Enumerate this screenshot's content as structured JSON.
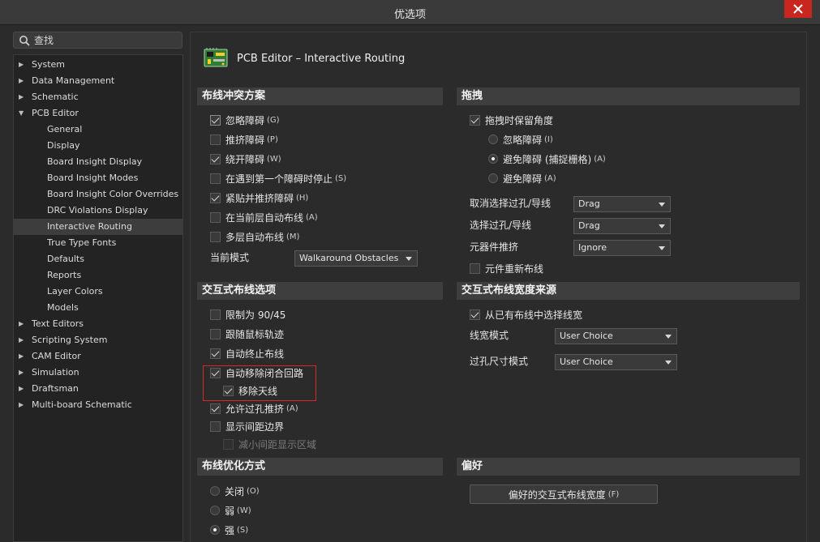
{
  "window": {
    "title": "优选项"
  },
  "search": {
    "placeholder": "查找"
  },
  "tree": {
    "items": [
      {
        "label": "System",
        "level": 0,
        "expanded": false
      },
      {
        "label": "Data Management",
        "level": 0,
        "expanded": false
      },
      {
        "label": "Schematic",
        "level": 0,
        "expanded": false
      },
      {
        "label": "PCB Editor",
        "level": 0,
        "expanded": true
      },
      {
        "label": "General",
        "level": 1
      },
      {
        "label": "Display",
        "level": 1
      },
      {
        "label": "Board Insight Display",
        "level": 1
      },
      {
        "label": "Board Insight Modes",
        "level": 1
      },
      {
        "label": "Board Insight Color Overrides",
        "level": 1
      },
      {
        "label": "DRC Violations Display",
        "level": 1
      },
      {
        "label": "Interactive Routing",
        "level": 1,
        "selected": true
      },
      {
        "label": "True Type Fonts",
        "level": 1
      },
      {
        "label": "Defaults",
        "level": 1
      },
      {
        "label": "Reports",
        "level": 1
      },
      {
        "label": "Layer Colors",
        "level": 1
      },
      {
        "label": "Models",
        "level": 1
      },
      {
        "label": "Text Editors",
        "level": 0,
        "expanded": false
      },
      {
        "label": "Scripting System",
        "level": 0,
        "expanded": false
      },
      {
        "label": "CAM Editor",
        "level": 0,
        "expanded": false
      },
      {
        "label": "Simulation",
        "level": 0,
        "expanded": false
      },
      {
        "label": "Draftsman",
        "level": 0,
        "expanded": false
      },
      {
        "label": "Multi-board Schematic",
        "level": 0,
        "expanded": false
      }
    ]
  },
  "page": {
    "title": "PCB Editor – Interactive Routing"
  },
  "conflict": {
    "header": "布线冲突方案",
    "options": [
      {
        "label": "忽略障碍",
        "hotkey": "(G)",
        "checked": true
      },
      {
        "label": "推挤障碍",
        "hotkey": "(P)",
        "checked": false
      },
      {
        "label": "绕开障碍",
        "hotkey": "(W)",
        "checked": true
      },
      {
        "label": "在遇到第一个障碍时停止",
        "hotkey": "(S)",
        "checked": false
      },
      {
        "label": "紧贴并推挤障碍",
        "hotkey": "(H)",
        "checked": true
      },
      {
        "label": "在当前层自动布线",
        "hotkey": "(A)",
        "checked": false
      },
      {
        "label": "多层自动布线",
        "hotkey": "(M)",
        "checked": false
      }
    ],
    "mode_label": "当前模式",
    "mode_value": "Walkaround Obstacles"
  },
  "drag": {
    "header": "拖拽",
    "preserve_angle": {
      "label": "拖拽时保留角度",
      "checked": true
    },
    "radios": [
      {
        "label": "忽略障碍",
        "hotkey": "(I)",
        "checked": false
      },
      {
        "label": "避免障碍 (捕捉栅格)",
        "hotkey": "(A)",
        "checked": true
      },
      {
        "label": "避免障碍",
        "hotkey": "(A)",
        "checked": false
      }
    ],
    "fields": [
      {
        "label": "取消选择过孔/导线",
        "value": "Drag"
      },
      {
        "label": "选择过孔/导线",
        "value": "Drag"
      },
      {
        "label": "元器件推挤",
        "value": "Ignore"
      }
    ],
    "reroute": {
      "label": "元件重新布线",
      "checked": false
    }
  },
  "routing": {
    "header": "交互式布线选项",
    "options": [
      {
        "label": "限制为 90/45",
        "hotkey": "",
        "checked": false
      },
      {
        "label": "跟随鼠标轨迹",
        "hotkey": "",
        "checked": false
      },
      {
        "label": "自动终止布线",
        "hotkey": "",
        "checked": true
      },
      {
        "label": "自动移除闭合回路",
        "hotkey": "",
        "checked": true
      },
      {
        "label": "移除天线",
        "hotkey": "",
        "checked": true
      },
      {
        "label": "允许过孔推挤",
        "hotkey": "(A)",
        "checked": true
      },
      {
        "label": "显示间距边界",
        "hotkey": "",
        "checked": false
      },
      {
        "label": "减小间距显示区域",
        "hotkey": "",
        "checked": false,
        "disabled": true
      }
    ]
  },
  "width_source": {
    "header": "交互式布线宽度来源",
    "pick_existing": {
      "label": "从已有布线中选择线宽",
      "checked": true
    },
    "fields": [
      {
        "label": "线宽模式",
        "value": "User Choice"
      },
      {
        "label": "过孔尺寸模式",
        "value": "User Choice"
      }
    ]
  },
  "optimize": {
    "header": "布线优化方式",
    "radios": [
      {
        "label": "关闭",
        "hotkey": "(O)",
        "checked": false
      },
      {
        "label": "弱",
        "hotkey": "(W)",
        "checked": false
      },
      {
        "label": "强",
        "hotkey": "(S)",
        "checked": true
      }
    ]
  },
  "prefs": {
    "header": "偏好",
    "button_label": "偏好的交互式布线宽度",
    "button_hotkey": "(F)"
  },
  "colors": {
    "close": "#c8261f",
    "highlight": "#d42a2a",
    "selected": "#3d3d3d"
  }
}
